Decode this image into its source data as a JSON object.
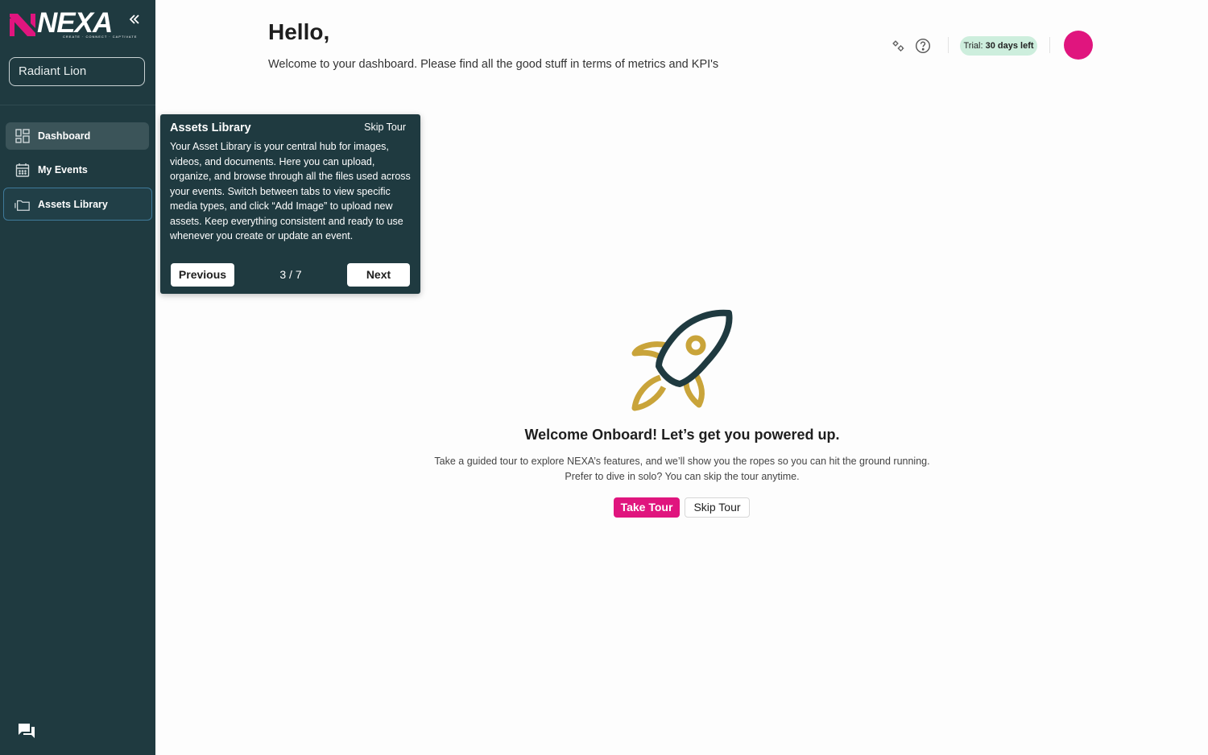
{
  "brand": {
    "name": "NEXA",
    "tagline": "CREATE · CONNECT · CAPTIVATE"
  },
  "sidebar": {
    "org": "Radiant Lion",
    "items": [
      {
        "label": "Dashboard"
      },
      {
        "label": "My Events"
      },
      {
        "label": "Assets Library"
      }
    ]
  },
  "header": {
    "greeting": "Hello,",
    "subtitle": "Welcome to your dashboard. Please find all the good stuff in terms of metrics and KPI's",
    "trial_prefix": "Trial:",
    "trial_days": "30 days left"
  },
  "tour": {
    "title": "Assets Library",
    "skip": "Skip Tour",
    "body": "Your Asset Library is your central hub for images, videos, and documents. Here you can upload, organize, and browse through all the files used across your events. Switch between tabs to view specific media types, and click “Add Image” to upload new assets. Keep everything consistent and ready to use whenever you create or update an event.",
    "previous": "Previous",
    "next": "Next",
    "step": "3 / 7"
  },
  "welcome": {
    "title": "Welcome Onboard! Let’s get you powered up.",
    "line1": "Take a guided tour to explore NEXA’s features, and we’ll show you the ropes so you can hit the ground running.",
    "line2": "Prefer to dive in solo? You can skip the tour anytime.",
    "take_tour": "Take Tour",
    "skip_tour": "Skip Tour"
  },
  "colors": {
    "sidebar": "#1f3a40",
    "accent": "#e0157e",
    "trial_bg": "#cdeedd",
    "rocket_body": "#1f3a40",
    "rocket_flame": "#c9a43a"
  }
}
